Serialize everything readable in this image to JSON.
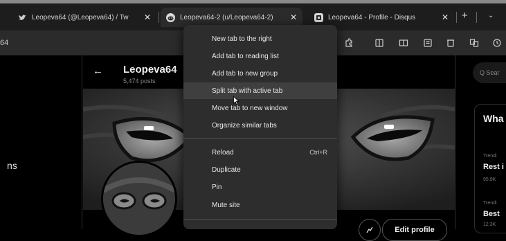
{
  "tabs": [
    {
      "title": "Leopeva64 (@Leopeva64) / Tw",
      "active": false
    },
    {
      "title": "Leopeva64-2 (u/Leopeva64-2)",
      "active": true
    },
    {
      "title": "Leopeva64 - Profile - Disqus",
      "active": false
    }
  ],
  "address_fragment": "64",
  "profile": {
    "name": "Leopeva64",
    "posts": "5,474 posts",
    "edit_label": "Edit profile"
  },
  "left_nav_fragment": "ns",
  "right_sidebar": {
    "search_placeholder": "Q Sear",
    "heading": "Wha",
    "trends": [
      {
        "small": "Trendi",
        "big": "Rest i",
        "count": "95.9K"
      },
      {
        "small": "Trendi",
        "big": "Best",
        "count": "12.3K"
      }
    ]
  },
  "context_menu": {
    "items": [
      {
        "label": "New tab to the right",
        "shortcut": ""
      },
      {
        "label": "Add tab to reading list",
        "shortcut": ""
      },
      {
        "label": "Add tab to new group",
        "shortcut": ""
      },
      {
        "label": "Split tab with active tab",
        "shortcut": "",
        "highlighted": true
      },
      {
        "label": "Move tab to new window",
        "shortcut": ""
      },
      {
        "label": "Organize similar tabs",
        "shortcut": ""
      },
      {
        "label": "Reload",
        "shortcut": "Ctrl+R"
      },
      {
        "label": "Duplicate",
        "shortcut": ""
      },
      {
        "label": "Pin",
        "shortcut": ""
      },
      {
        "label": "Mute site",
        "shortcut": ""
      }
    ]
  },
  "colors": {
    "menu_bg": "#2d2d2d",
    "menu_highlight": "#3f3f3f",
    "tabstrip_bg": "#1d1d1d",
    "toolbar_bg": "#2b2b2b",
    "page_bg": "#000000"
  },
  "icons": [
    "twitter-icon",
    "reddit-icon",
    "disqus-icon",
    "tab-close-icon",
    "new-tab-icon",
    "tab-search-icon",
    "extensions-icon",
    "split-screen-icon",
    "reading-view-icon",
    "favorites-icon",
    "collections-icon",
    "translate-icon",
    "history-icon",
    "back-arrow-icon",
    "search-icon",
    "mouse-cursor-icon"
  ]
}
